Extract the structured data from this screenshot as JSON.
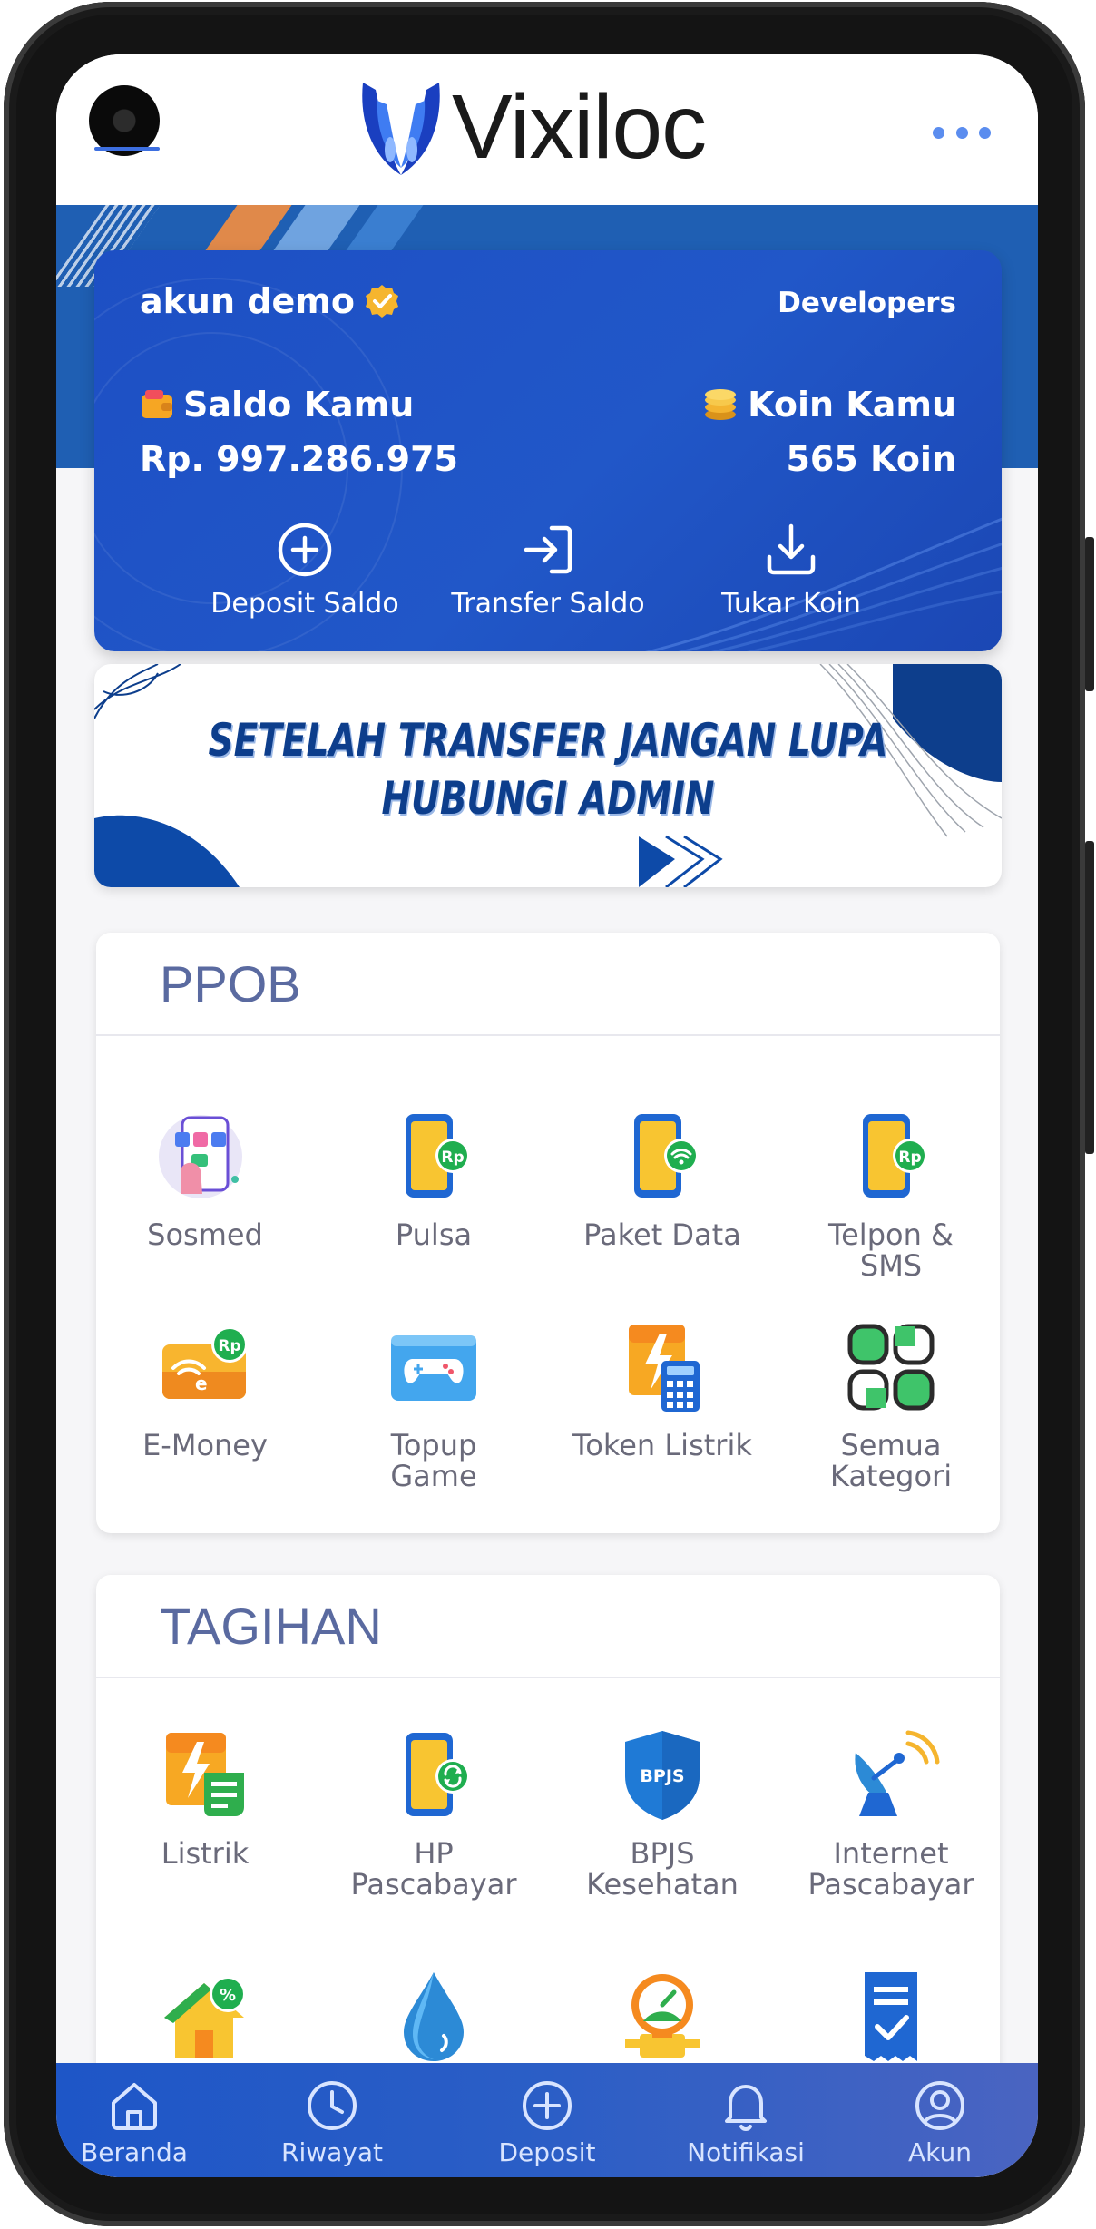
{
  "app": {
    "name": "Vixiloc"
  },
  "account": {
    "name": "akun demo",
    "developers_label": "Developers",
    "saldo_label": "Saldo Kamu",
    "saldo_value": "Rp. 997.286.975",
    "koin_label": "Koin Kamu",
    "koin_value": "565 Koin"
  },
  "card_actions": [
    {
      "label": "Deposit Saldo",
      "icon": "plus-circle-icon"
    },
    {
      "label": "Transfer Saldo",
      "icon": "login-arrow-icon"
    },
    {
      "label": "Tukar Koin",
      "icon": "download-icon"
    }
  ],
  "promo": {
    "line1": "SETELAH TRANSFER JANGAN LUPA",
    "line2": "HUBUNGI ADMIN"
  },
  "ppob": {
    "title": "PPOB",
    "items": [
      {
        "label": "Sosmed",
        "icon": "social-media-icon"
      },
      {
        "label": "Pulsa",
        "icon": "phone-credit-icon"
      },
      {
        "label": "Paket Data",
        "icon": "data-package-icon"
      },
      {
        "label": "Telpon &",
        "label2": "SMS",
        "icon": "phone-sms-icon"
      },
      {
        "label": "E-Money",
        "icon": "e-money-icon"
      },
      {
        "label": "Topup",
        "label2": "Game",
        "icon": "gamepad-icon"
      },
      {
        "label": "Token Listrik",
        "icon": "electric-token-icon"
      },
      {
        "label": "Semua",
        "label2": "Kategori",
        "icon": "all-categories-icon"
      }
    ]
  },
  "tagihan": {
    "title": "TAGIHAN",
    "items": [
      {
        "label": "Listrik",
        "icon": "electric-bill-icon"
      },
      {
        "label": "HP",
        "label2": "Pascabayar",
        "icon": "postpaid-phone-icon"
      },
      {
        "label": "BPJS",
        "label2": "Kesehatan",
        "icon": "bpjs-icon",
        "badge": "BPJS"
      },
      {
        "label": "Internet",
        "label2": "Pascabayar",
        "icon": "satellite-dish-icon"
      },
      {
        "icon": "house-tax-icon"
      },
      {
        "icon": "water-drop-icon"
      },
      {
        "icon": "gas-meter-icon"
      },
      {
        "icon": "receipt-icon"
      }
    ]
  },
  "bottom_nav": [
    {
      "label": "Beranda",
      "icon": "home-icon"
    },
    {
      "label": "Riwayat",
      "icon": "clock-icon"
    },
    {
      "label": "Deposit",
      "icon": "plus-circle-icon"
    },
    {
      "label": "Notifikasi",
      "icon": "bell-icon"
    },
    {
      "label": "Akun",
      "icon": "user-circle-icon"
    }
  ],
  "colors": {
    "primary": "#1f55c4",
    "section_title": "#5a6aa0",
    "label": "#6a6a7a",
    "accent_orange": "#f7a823",
    "accent_green": "#2fae4d"
  }
}
